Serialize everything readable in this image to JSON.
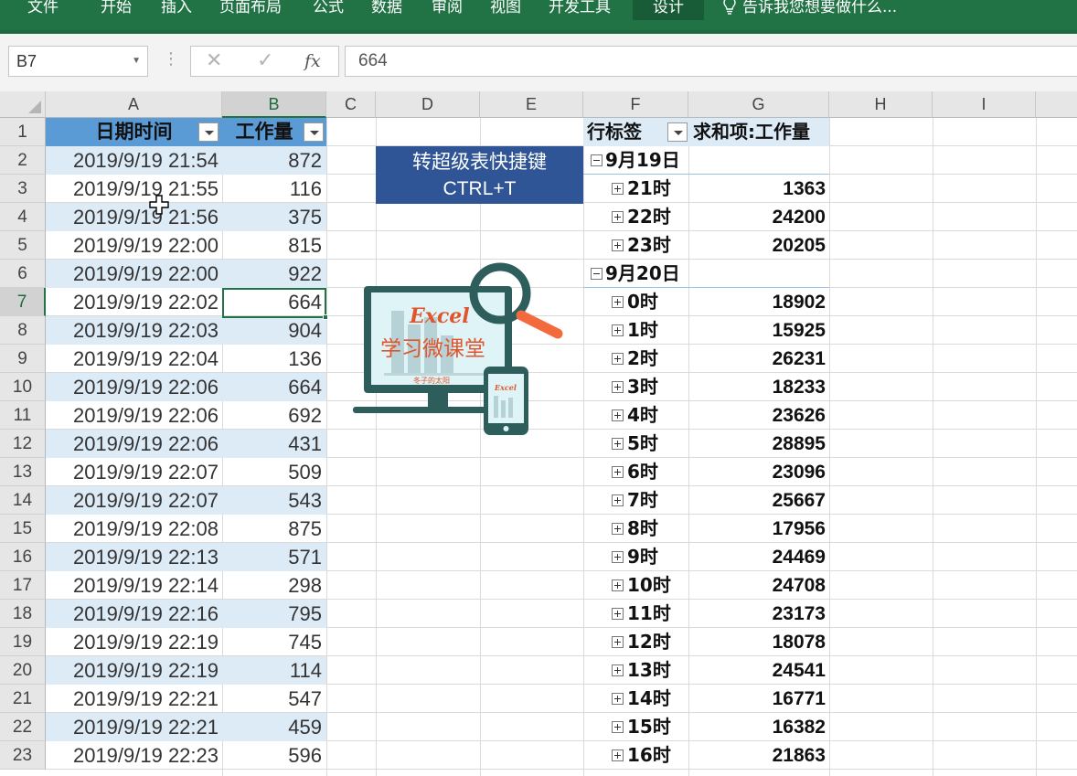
{
  "ribbon": {
    "tabs": [
      "文件",
      "开始",
      "插入",
      "页面布局",
      "公式",
      "数据",
      "审阅",
      "视图",
      "开发工具",
      "设计"
    ],
    "active_tab": "设计",
    "tell_me": "告诉我您想要做什么..."
  },
  "formula_bar": {
    "name_box": "B7",
    "cancel_icon": "✕",
    "enter_icon": "✓",
    "fx_label": "fx",
    "value": "664"
  },
  "columns": [
    "A",
    "B",
    "C",
    "D",
    "E",
    "F",
    "G",
    "H",
    "I"
  ],
  "rows": [
    "1",
    "2",
    "3",
    "4",
    "5",
    "6",
    "7",
    "8",
    "9",
    "10",
    "11",
    "12",
    "13",
    "14",
    "15",
    "16",
    "17",
    "18",
    "19",
    "20",
    "21",
    "22",
    "23"
  ],
  "table": {
    "headers": [
      "日期时间",
      "工作量"
    ],
    "rows": [
      [
        "2019/9/19 21:54",
        "872"
      ],
      [
        "2019/9/19 21:55",
        "116"
      ],
      [
        "2019/9/19 21:56",
        "375"
      ],
      [
        "2019/9/19 22:00",
        "815"
      ],
      [
        "2019/9/19 22:00",
        "922"
      ],
      [
        "2019/9/19 22:02",
        "664"
      ],
      [
        "2019/9/19 22:03",
        "904"
      ],
      [
        "2019/9/19 22:04",
        "136"
      ],
      [
        "2019/9/19 22:06",
        "664"
      ],
      [
        "2019/9/19 22:06",
        "692"
      ],
      [
        "2019/9/19 22:06",
        "431"
      ],
      [
        "2019/9/19 22:07",
        "509"
      ],
      [
        "2019/9/19 22:07",
        "543"
      ],
      [
        "2019/9/19 22:08",
        "875"
      ],
      [
        "2019/9/19 22:13",
        "571"
      ],
      [
        "2019/9/19 22:14",
        "298"
      ],
      [
        "2019/9/19 22:16",
        "795"
      ],
      [
        "2019/9/19 22:19",
        "745"
      ],
      [
        "2019/9/19 22:19",
        "114"
      ],
      [
        "2019/9/19 22:21",
        "547"
      ],
      [
        "2019/9/19 22:21",
        "459"
      ],
      [
        "2019/9/19 22:23",
        "596"
      ]
    ]
  },
  "shortcut_box": {
    "line1": "转超级表快捷键",
    "line2": "CTRL+T"
  },
  "logo": {
    "title": "Excel",
    "subtitle": "学习微课堂",
    "author": "冬子的太阳",
    "phone_title": "Excel"
  },
  "pivot": {
    "header_label": "行标签",
    "header_value": "求和项:工作量",
    "items": [
      {
        "level": 0,
        "label": "9月19日",
        "value": ""
      },
      {
        "level": 1,
        "label": "21时",
        "value": "1363"
      },
      {
        "level": 1,
        "label": "22时",
        "value": "24200"
      },
      {
        "level": 1,
        "label": "23时",
        "value": "20205"
      },
      {
        "level": 0,
        "label": "9月20日",
        "value": ""
      },
      {
        "level": 1,
        "label": "0时",
        "value": "18902"
      },
      {
        "level": 1,
        "label": "1时",
        "value": "15925"
      },
      {
        "level": 1,
        "label": "2时",
        "value": "26231"
      },
      {
        "level": 1,
        "label": "3时",
        "value": "18233"
      },
      {
        "level": 1,
        "label": "4时",
        "value": "23626"
      },
      {
        "level": 1,
        "label": "5时",
        "value": "28895"
      },
      {
        "level": 1,
        "label": "6时",
        "value": "23096"
      },
      {
        "level": 1,
        "label": "7时",
        "value": "25667"
      },
      {
        "level": 1,
        "label": "8时",
        "value": "17956"
      },
      {
        "level": 1,
        "label": "9时",
        "value": "24469"
      },
      {
        "level": 1,
        "label": "10时",
        "value": "24708"
      },
      {
        "level": 1,
        "label": "11时",
        "value": "23173"
      },
      {
        "level": 1,
        "label": "12时",
        "value": "18078"
      },
      {
        "level": 1,
        "label": "13时",
        "value": "24541"
      },
      {
        "level": 1,
        "label": "14时",
        "value": "16771"
      },
      {
        "level": 1,
        "label": "15时",
        "value": "16382"
      },
      {
        "level": 1,
        "label": "16时",
        "value": "21863"
      }
    ]
  },
  "colors": {
    "ribbon": "#217346",
    "table_header": "#5b9bd5",
    "table_band": "#ddebf7",
    "shortcut_box": "#2f5597",
    "logo_teal": "#2e5e5c",
    "logo_accent": "#f26a3d"
  }
}
